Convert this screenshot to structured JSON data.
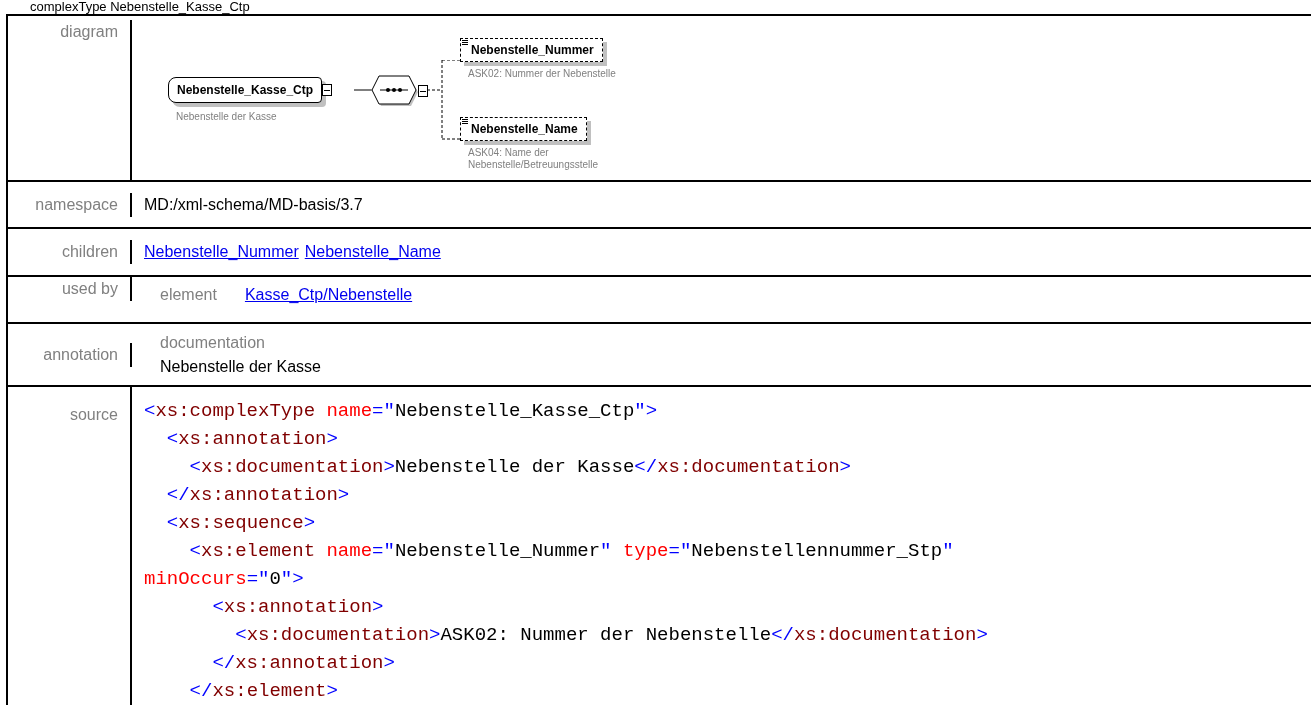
{
  "title": "complexType Nebenstelle_Kasse_Ctp",
  "rows": {
    "diagram": "diagram",
    "namespace": "namespace",
    "children": "children",
    "used_by": "used by",
    "annotation": "annotation",
    "source": "source"
  },
  "diagram": {
    "main": {
      "name": "Nebenstelle_Kasse_Ctp",
      "doc": "Nebenstelle der Kasse"
    },
    "children": [
      {
        "name": "Nebenstelle_Nummer",
        "doc": "ASK02: Nummer der Nebenstelle",
        "optional": true
      },
      {
        "name": "Nebenstelle_Name",
        "doc": "ASK04: Name der Nebenstelle/Betreuungsstelle",
        "optional": true
      }
    ]
  },
  "namespace": "MD:/xml-schema/MD-basis/3.7",
  "children": [
    "Nebenstelle_Nummer",
    "Nebenstelle_Name"
  ],
  "used_by": {
    "kind": "element",
    "link": "Kasse_Ctp/Nebenstelle"
  },
  "annotation": {
    "label": "documentation",
    "text": "Nebenstelle der Kasse"
  },
  "source": [
    [
      {
        "kind": "bracket",
        "text": "<"
      },
      {
        "kind": "tag",
        "text": "xs:complexType"
      },
      {
        "kind": "attr",
        "text": " name"
      },
      {
        "kind": "bracket",
        "text": "=\""
      },
      {
        "kind": "text",
        "text": "Nebenstelle_Kasse_Ctp"
      },
      {
        "kind": "bracket",
        "text": "\">"
      }
    ],
    [
      {
        "kind": "bracket",
        "text": "  <"
      },
      {
        "kind": "tag",
        "text": "xs:annotation"
      },
      {
        "kind": "bracket",
        "text": ">"
      }
    ],
    [
      {
        "kind": "bracket",
        "text": "    <"
      },
      {
        "kind": "tag",
        "text": "xs:documentation"
      },
      {
        "kind": "bracket",
        "text": ">"
      },
      {
        "kind": "text",
        "text": "Nebenstelle der Kasse"
      },
      {
        "kind": "bracket",
        "text": "</"
      },
      {
        "kind": "tag",
        "text": "xs:documentation"
      },
      {
        "kind": "bracket",
        "text": ">"
      }
    ],
    [
      {
        "kind": "bracket",
        "text": "  </"
      },
      {
        "kind": "tag",
        "text": "xs:annotation"
      },
      {
        "kind": "bracket",
        "text": ">"
      }
    ],
    [
      {
        "kind": "bracket",
        "text": "  <"
      },
      {
        "kind": "tag",
        "text": "xs:sequence"
      },
      {
        "kind": "bracket",
        "text": ">"
      }
    ],
    [
      {
        "kind": "bracket",
        "text": "    <"
      },
      {
        "kind": "tag",
        "text": "xs:element"
      },
      {
        "kind": "attr",
        "text": " name"
      },
      {
        "kind": "bracket",
        "text": "=\""
      },
      {
        "kind": "text",
        "text": "Nebenstelle_Nummer"
      },
      {
        "kind": "bracket",
        "text": "\""
      },
      {
        "kind": "attr",
        "text": " type"
      },
      {
        "kind": "bracket",
        "text": "=\""
      },
      {
        "kind": "text",
        "text": "Nebenstellennummer_Stp"
      },
      {
        "kind": "bracket",
        "text": "\""
      }
    ],
    [
      {
        "kind": "attr",
        "text": "minOccurs"
      },
      {
        "kind": "bracket",
        "text": "=\""
      },
      {
        "kind": "text",
        "text": "0"
      },
      {
        "kind": "bracket",
        "text": "\">"
      }
    ],
    [
      {
        "kind": "bracket",
        "text": "      <"
      },
      {
        "kind": "tag",
        "text": "xs:annotation"
      },
      {
        "kind": "bracket",
        "text": ">"
      }
    ],
    [
      {
        "kind": "bracket",
        "text": "        <"
      },
      {
        "kind": "tag",
        "text": "xs:documentation"
      },
      {
        "kind": "bracket",
        "text": ">"
      },
      {
        "kind": "text",
        "text": "ASK02: Nummer der Nebenstelle"
      },
      {
        "kind": "bracket",
        "text": "</"
      },
      {
        "kind": "tag",
        "text": "xs:documentation"
      },
      {
        "kind": "bracket",
        "text": ">"
      }
    ],
    [
      {
        "kind": "bracket",
        "text": "      </"
      },
      {
        "kind": "tag",
        "text": "xs:annotation"
      },
      {
        "kind": "bracket",
        "text": ">"
      }
    ],
    [
      {
        "kind": "bracket",
        "text": "    </"
      },
      {
        "kind": "tag",
        "text": "xs:element"
      },
      {
        "kind": "bracket",
        "text": ">"
      }
    ]
  ]
}
